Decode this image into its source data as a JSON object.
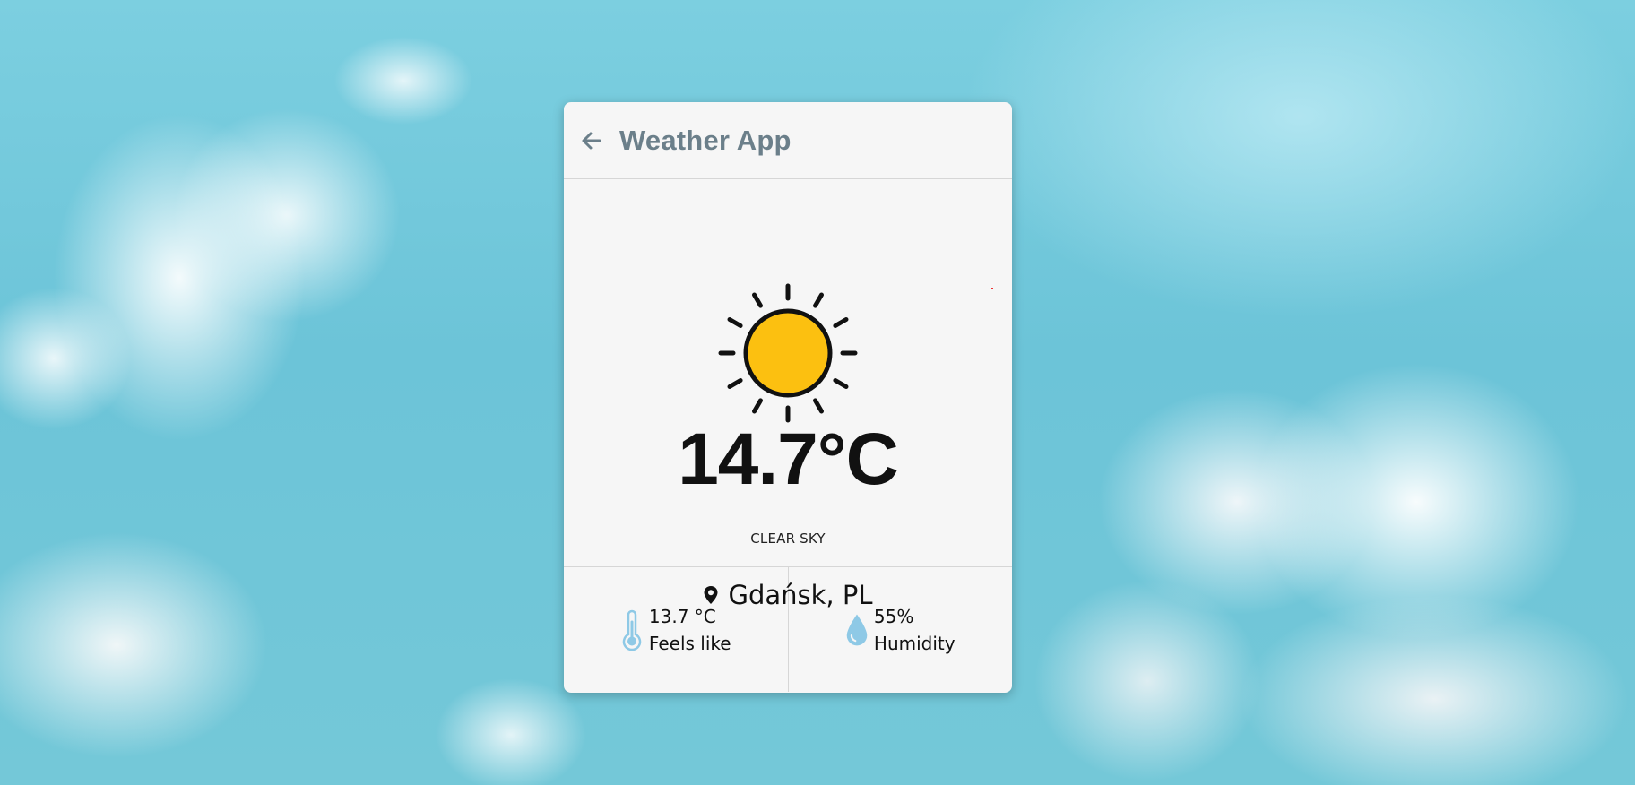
{
  "header": {
    "title": "Weather App",
    "back_icon": "arrow-left-icon"
  },
  "weather": {
    "icon": "sun-icon",
    "temperature": "14.7°C",
    "description": "CLEAR SKY",
    "location_icon": "map-pin-icon",
    "location": "Gdańsk, PL"
  },
  "stats": {
    "feels_like": {
      "icon": "thermometer-icon",
      "value": "13.7 °C",
      "label": "Feels like"
    },
    "humidity": {
      "icon": "water-drop-icon",
      "value": "55%",
      "label": "Humidity"
    }
  },
  "colors": {
    "title": "#6b7f8a",
    "sun_fill": "#fcc010",
    "icon_accent": "#8ec9e6",
    "card_background": "#f6f6f6"
  }
}
